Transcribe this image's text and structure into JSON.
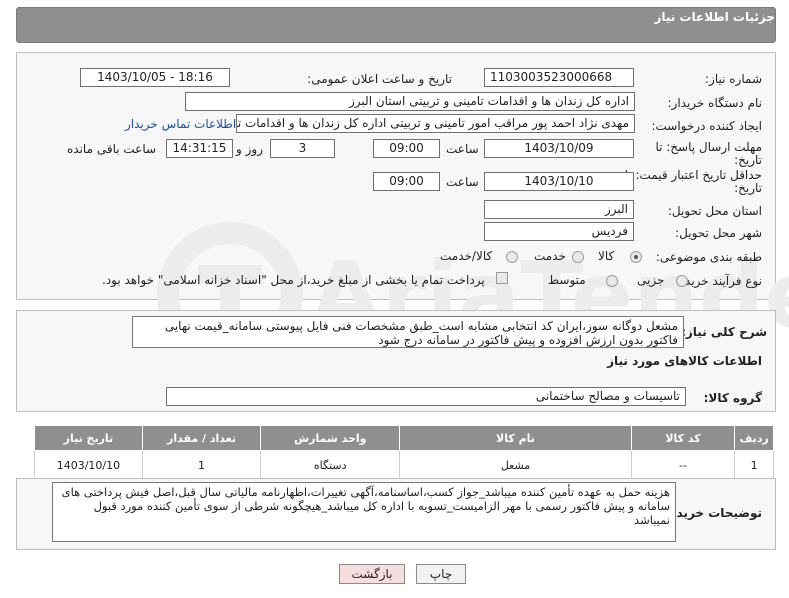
{
  "header": {
    "title": "جزئیات اطلاعات نیاز"
  },
  "form": {
    "need_number": {
      "label": "شماره نیاز:",
      "value": "1103003523000668"
    },
    "announce": {
      "label": "تاریخ و ساعت اعلان عمومی:",
      "value": "1403/10/05 - 18:16"
    },
    "buyer": {
      "label": "نام دستگاه خریدار:",
      "value": "اداره کل زندان ها و اقدامات تامینی و تربیتی استان البرز"
    },
    "requester": {
      "label": "ایجاد کننده درخواست:",
      "value": "مهدی نژاد احمد پور مراقب امور تامینی و تربیتی اداره کل زندان ها و اقدامات تامینی",
      "contact_link": "اطلاعات تماس خریدار"
    },
    "deadline": {
      "label_line1": "مهلت ارسال پاسخ: تا",
      "label_line2": "تاریخ:",
      "date": "1403/10/09",
      "time_label": "ساعت",
      "time": "09:00",
      "days": "3",
      "days_label": "روز و",
      "remaining": "14:31:15",
      "remaining_label": "ساعت باقی مانده"
    },
    "validity": {
      "label_line1": "حداقل تاریخ اعتبار قیمت: تا",
      "label_line2": "تاریخ:",
      "date": "1403/10/10",
      "time_label": "ساعت",
      "time": "09:00"
    },
    "province": {
      "label": "استان محل تحویل:",
      "value": "البرز"
    },
    "city": {
      "label": "شهر محل تحویل:",
      "value": "فردیس"
    },
    "category": {
      "label": "طبقه بندی موضوعی:",
      "options": [
        "کالا",
        "خدمت",
        "کالا/خدمت"
      ],
      "selected": "کالا"
    },
    "process": {
      "label": "نوع فرآیند خرید :",
      "options": [
        "جزیی",
        "متوسط"
      ],
      "payment_note": "پرداخت تمام یا بخشی از مبلغ خرید،از محل \"اسناد خزانه اسلامی\" خواهد بود."
    }
  },
  "description": {
    "label": "شرح کلی نیاز:",
    "text": "مشعل دوگانه سوز،ایران کد انتخابی مشابه است_طبق مشخصات فنی فایل پیوستی سامانه_قیمت نهایی فاکتور بدون ارزش افزوده و پیش فاکتور در سامانه درج شود"
  },
  "goods_info": {
    "title": "اطلاعات کالاهای مورد نیاز",
    "group_label": "گروه کالا:",
    "group_value": "تاسیسات و مصالح ساختمانی"
  },
  "table": {
    "headers": [
      "ردیف",
      "کد کالا",
      "نام کالا",
      "واحد شمارش",
      "تعداد / مقدار",
      "تاریخ نیاز"
    ],
    "rows": [
      [
        "1",
        "--",
        "مشعل",
        "دستگاه",
        "1",
        "1403/10/10"
      ]
    ]
  },
  "buyer_notes": {
    "label": "توضیحات خریدار:",
    "text": "هزینه حمل به عهده تأمین کننده میباشد_جواز کسب،اساسنامه،آگهی تغییرات،اظهارنامه مالیاتی سال قبل،اصل فیش پرداختی های سامانه و پیش فاکتور رسمی با مهر الزامیست_تسویه با اداره کل میباشد_هیچگونه شرطی از سوی تأمین کننده مورد قبول نمیباشد"
  },
  "buttons": {
    "print": "چاپ",
    "back": "بازگشت"
  },
  "watermark": {
    "text": "AriaTender.neT"
  },
  "colors": {
    "header_bg": "#8f8f8f",
    "link": "#1a4fa3",
    "back_button": "#f7dede"
  }
}
